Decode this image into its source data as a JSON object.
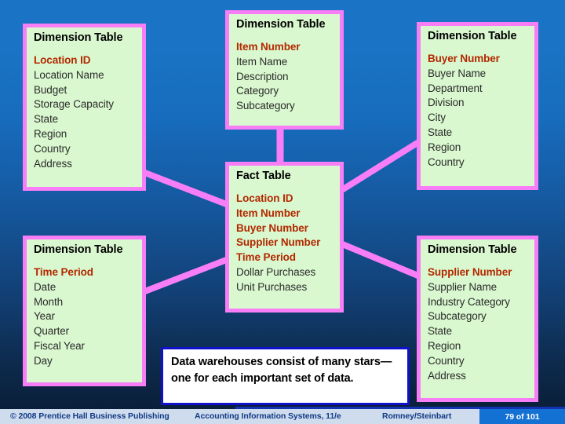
{
  "slide": {
    "background_top_color": "#1a73c4",
    "background_bottom_color": "#081a30",
    "box_fill_color": "#d9f8cf",
    "box_border_color": "#f77ef7",
    "key_field_color": "#b32800",
    "connector_color": "#f77ef7"
  },
  "entities": {
    "location": {
      "header": "Dimension Table",
      "fields": [
        "Location ID",
        "Location Name",
        "Budget",
        "Storage Capacity",
        "State",
        "Region",
        "Country",
        "Address"
      ],
      "key_count": 1
    },
    "item": {
      "header": "Dimension Table",
      "fields": [
        "Item Number",
        "Item Name",
        "Description",
        "Category",
        "Subcategory"
      ],
      "key_count": 1
    },
    "buyer": {
      "header": "Dimension Table",
      "fields": [
        "Buyer Number",
        "Buyer Name",
        "Department",
        "Division",
        "City",
        "State",
        "Region",
        "Country"
      ],
      "key_count": 1
    },
    "fact": {
      "header": "Fact Table",
      "fields": [
        "Location ID",
        "Item Number",
        "Buyer Number",
        "Supplier Number",
        "Time Period",
        "Dollar Purchases",
        "Unit Purchases"
      ],
      "key_count": 5
    },
    "time": {
      "header": "Dimension Table",
      "fields": [
        "Time Period",
        "Date",
        "Month",
        "Year",
        "Quarter",
        "Fiscal Year",
        "Day"
      ],
      "key_count": 1
    },
    "supplier": {
      "header": "Dimension Table",
      "fields": [
        "Supplier Number",
        "Supplier Name",
        "Industry Category",
        "Subcategory",
        "State",
        "Region",
        "Country",
        "Address"
      ],
      "key_count": 1
    }
  },
  "caption": {
    "text": "Data warehouses consist of many stars—one for each important set of data."
  },
  "footer": {
    "copyright": "© 2008 Prentice Hall Business Publishing",
    "title": "Accounting Information Systems, 11/e",
    "authors": "Romney/Steinbart",
    "page": "79 of 101"
  }
}
